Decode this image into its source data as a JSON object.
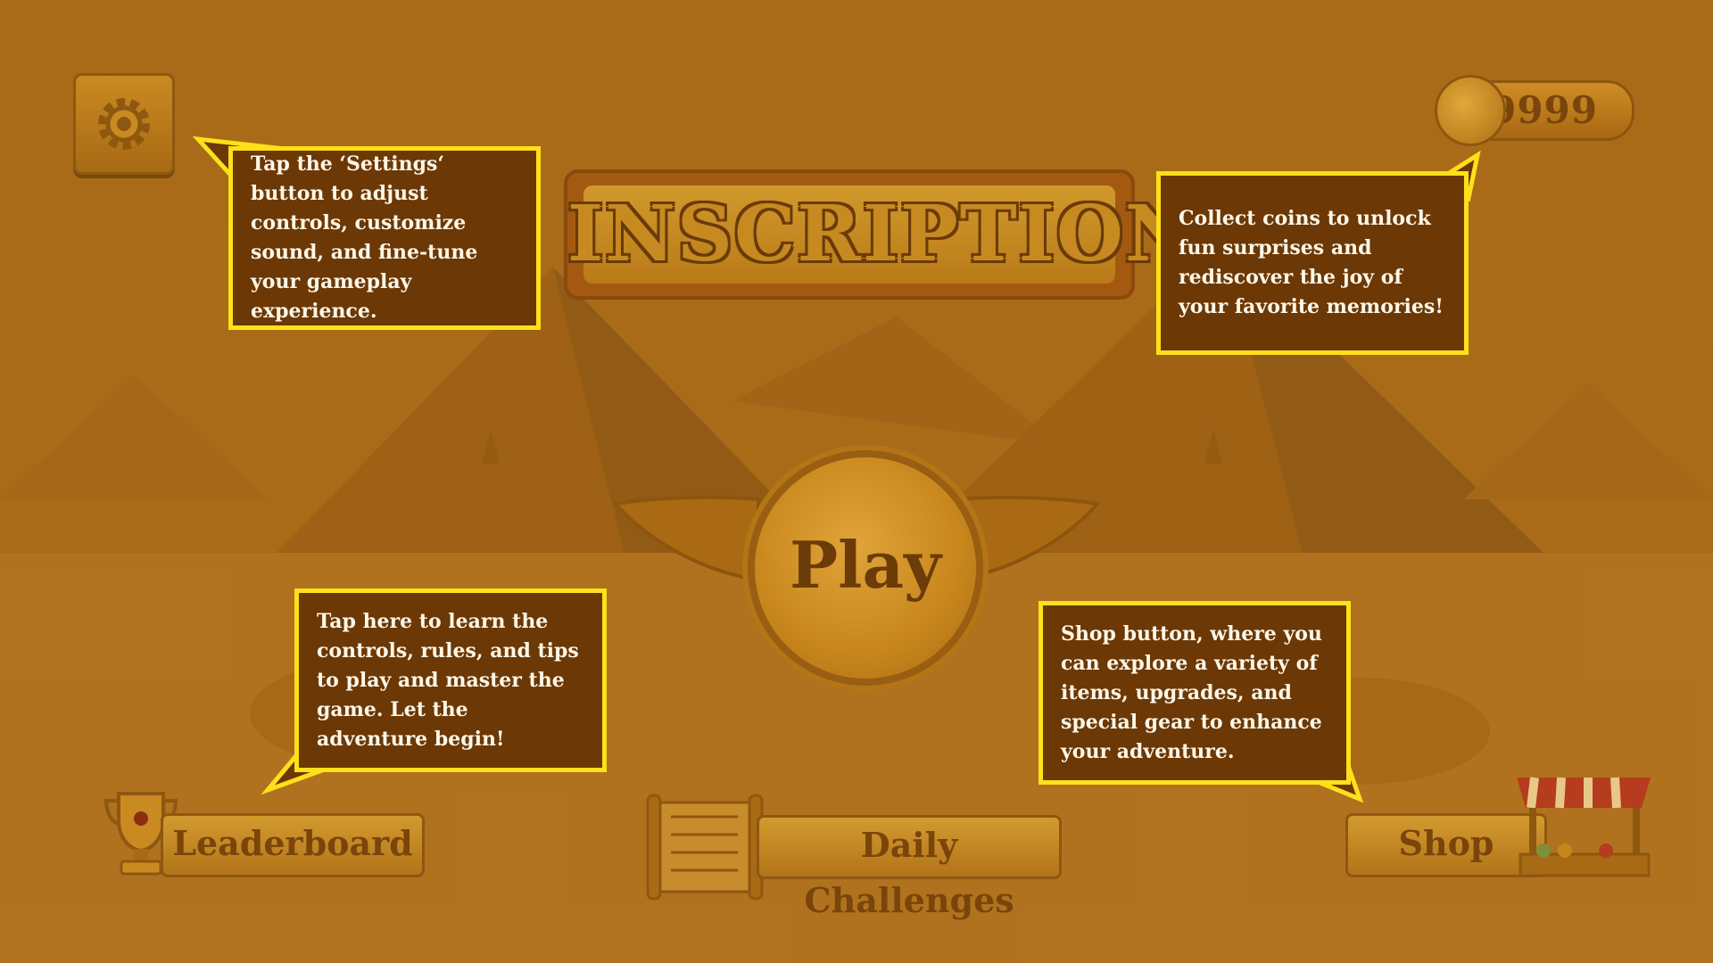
{
  "coins": {
    "count": "9999"
  },
  "title": "INSCRIPTION",
  "play_label": "Play",
  "bottom_buttons": {
    "leaderboard": "Leaderboard",
    "daily_challenges": "Daily Challenges",
    "shop": "Shop"
  },
  "tutorial": {
    "settings": "Tap the ‘Settings‘ button to adjust controls, customize sound, and fine-tune your gameplay experience.",
    "coins": "Collect coins to unlock fun surprises and rediscover the joy of your favorite memories!",
    "leaderboard": "Tap here to learn the controls, rules, and tips to play and master the game. Let the adventure begin!",
    "shop": "Shop button, where you can explore a variety of items, upgrades, and special gear to enhance your adventure."
  },
  "colors": {
    "overlay": "#b5731a",
    "callout_fill": "#6b3806",
    "callout_border": "#ffe01a",
    "button_text": "#7a450b"
  },
  "icons": {
    "settings": "gear-icon",
    "coin": "scarab-coin-icon",
    "leaderboard": "trophy-icon",
    "daily_challenges": "papyrus-scroll-icon",
    "shop": "market-stall-icon"
  }
}
